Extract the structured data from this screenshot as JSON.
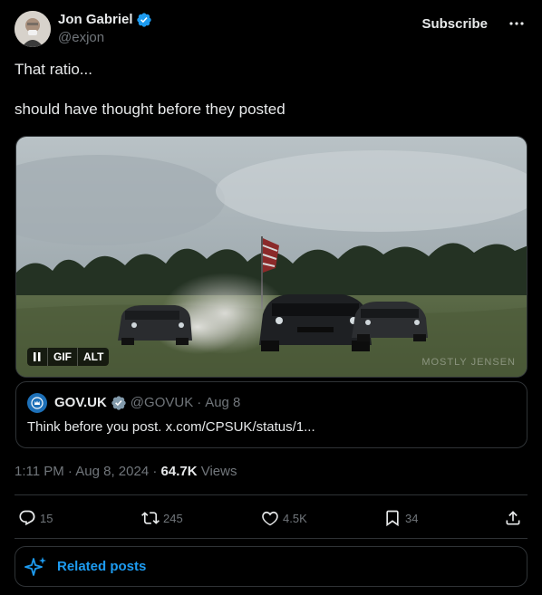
{
  "author": {
    "display_name": "Jon Gabriel",
    "handle": "@exjon",
    "verified": true,
    "avatar_icon": "user-avatar"
  },
  "header": {
    "subscribe_label": "Subscribe",
    "more_icon": "more-horizontal-icon"
  },
  "tweet": {
    "line1": "That ratio...",
    "line2": "should have thought before they posted"
  },
  "media": {
    "type": "GIF",
    "pause_icon": "pause-icon",
    "gif_label": "GIF",
    "alt_label": "ALT",
    "watermark": "MOSTLY JENSEN"
  },
  "quote": {
    "name": "GOV.UK",
    "verified_badge": "government-verified",
    "handle": "@GOVUK",
    "separator": "·",
    "date": "Aug 8",
    "text": "Think before you post. x.com/CPSUK/status/1..."
  },
  "meta": {
    "time": "1:11 PM",
    "dot1": " · ",
    "date": "Aug 8, 2024",
    "dot2": " · ",
    "views_count": "64.7K",
    "views_label": " Views"
  },
  "actions": {
    "replies": "15",
    "reposts": "245",
    "likes": "4.5K",
    "bookmarks": "34"
  },
  "related": {
    "label": "Related posts",
    "icon": "sparkle-icon"
  },
  "colors": {
    "background": "#000000",
    "text_primary": "#e7e9ea",
    "text_secondary": "#71767b",
    "accent": "#1d9bf0",
    "border": "#2f3336",
    "verified_blue": "#1d9bf0",
    "verified_gray": "#829aab"
  }
}
